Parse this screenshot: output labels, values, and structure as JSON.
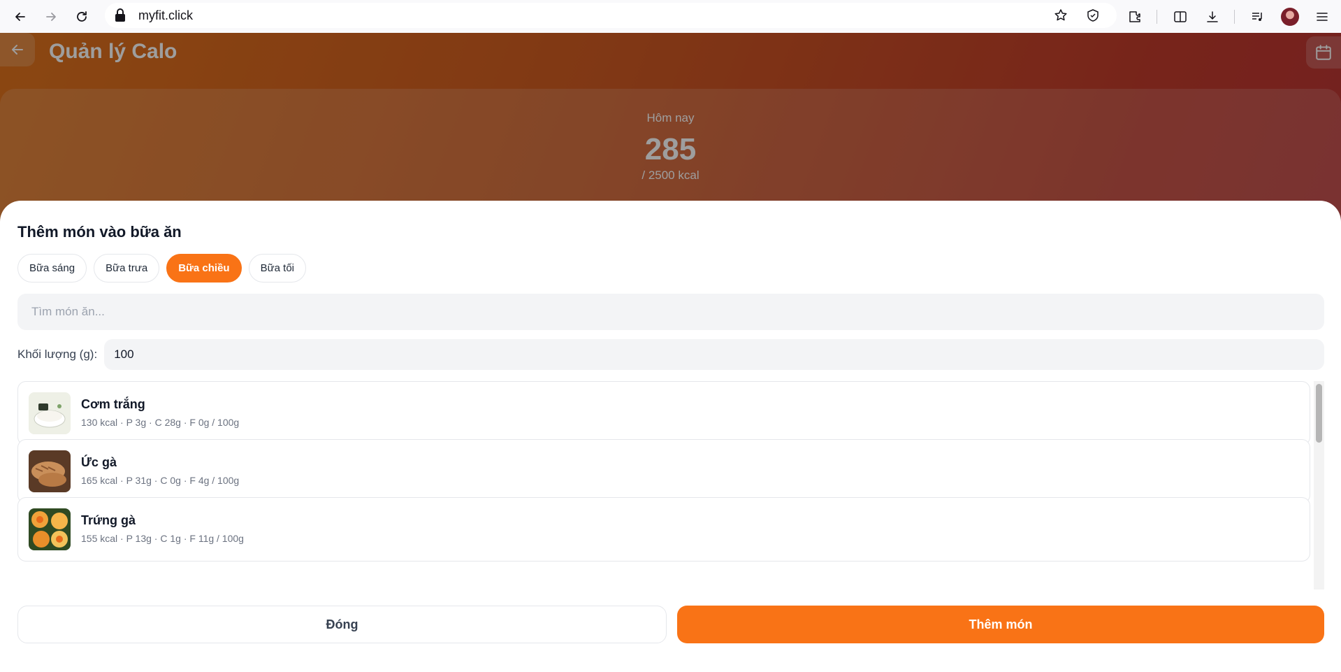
{
  "browser": {
    "url": "myfit.click",
    "icons": [
      "back-arrow-icon",
      "forward-arrow-icon",
      "reload-icon",
      "lock-icon",
      "star-icon",
      "shield-icon",
      "extensions-icon",
      "split-view-icon",
      "download-icon",
      "media-icon",
      "profile-avatar",
      "menu-icon"
    ]
  },
  "app": {
    "title": "Quản lý Calo",
    "summary": {
      "label": "Hôm nay",
      "value": "285",
      "target": "/ 2500 kcal",
      "progress_fraction": 0.114
    }
  },
  "sheet": {
    "title": "Thêm món vào bữa ăn",
    "meal_tabs": [
      {
        "label": "Bữa sáng",
        "active": false
      },
      {
        "label": "Bữa trưa",
        "active": false
      },
      {
        "label": "Bữa chiều",
        "active": true
      },
      {
        "label": "Bữa tối",
        "active": false
      }
    ],
    "search_placeholder": "Tìm món ăn...",
    "weight_label": "Khối lượng (g):",
    "weight_value": "100",
    "foods": [
      {
        "name": "Cơm trắng",
        "meta": "130 kcal · P 3g · C 28g · F 0g / 100g",
        "thumb": "rice-bowl"
      },
      {
        "name": "Ức gà",
        "meta": "165 kcal · P 31g · C 0g · F 4g / 100g",
        "thumb": "chicken-breast"
      },
      {
        "name": "Trứng gà",
        "meta": "155 kcal · P 13g · C 1g · F 11g / 100g",
        "thumb": "eggs"
      }
    ],
    "close_label": "Đóng",
    "add_label": "Thêm món"
  },
  "colors": {
    "accent": "#f97316",
    "header_gradient_start": "#e0731c",
    "header_gradient_end": "#b8333a"
  }
}
